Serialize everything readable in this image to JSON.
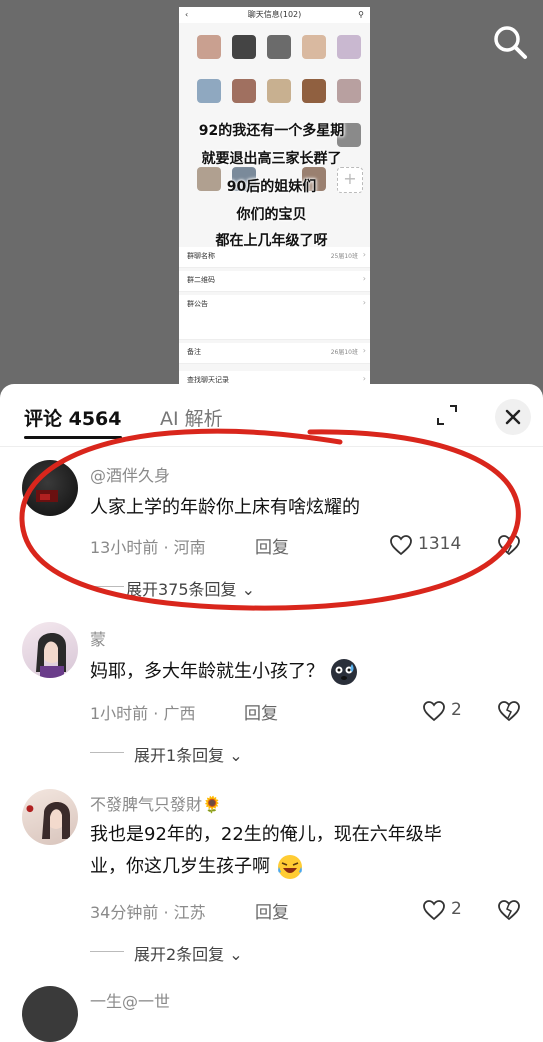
{
  "video": {
    "phone_title": "聊天信息(102)",
    "overlay_lines": [
      "92的我还有一个多星期",
      "就要退出高三家长群了",
      "90后的姐妹们",
      "你们的宝贝",
      "都在上几年级了呀"
    ],
    "rows": [
      {
        "label": "群聊名称",
        "value": "25届10班"
      },
      {
        "label": "群二维码",
        "value": ""
      },
      {
        "label": "群公告",
        "value": ""
      },
      {
        "label": "备注",
        "value": "26届10班"
      },
      {
        "label": "查找聊天记录",
        "value": ""
      }
    ]
  },
  "header": {
    "tab_comments": "评论 4564",
    "tab_ai": "AI 解析"
  },
  "comments": [
    {
      "user": "@酒伴久身",
      "text": "人家上学的年龄你上床有啥炫耀的",
      "time": "13小时前",
      "location": "河南",
      "reply": "回复",
      "likes": "1314",
      "expand": "展开375条回复"
    },
    {
      "user": "蒙",
      "text": "妈耶，多大年龄就生小孩了？",
      "time": "1小时前",
      "location": "广西",
      "reply": "回复",
      "likes": "2",
      "expand": "展开1条回复"
    },
    {
      "user": "不發脾气只發財🌻",
      "text_line1": "我也是92年的，22生的俺儿，现在六年级毕",
      "text_line2": "业，你这几岁生孩子啊",
      "time": "34分钟前",
      "location": "江苏",
      "reply": "回复",
      "likes": "2",
      "expand": "展开2条回复"
    },
    {
      "user": "一生@一世"
    }
  ],
  "meta_sep": " · ",
  "colors": {
    "annotation_red": "#d9261c",
    "text_gray": "#8a8a8a"
  }
}
